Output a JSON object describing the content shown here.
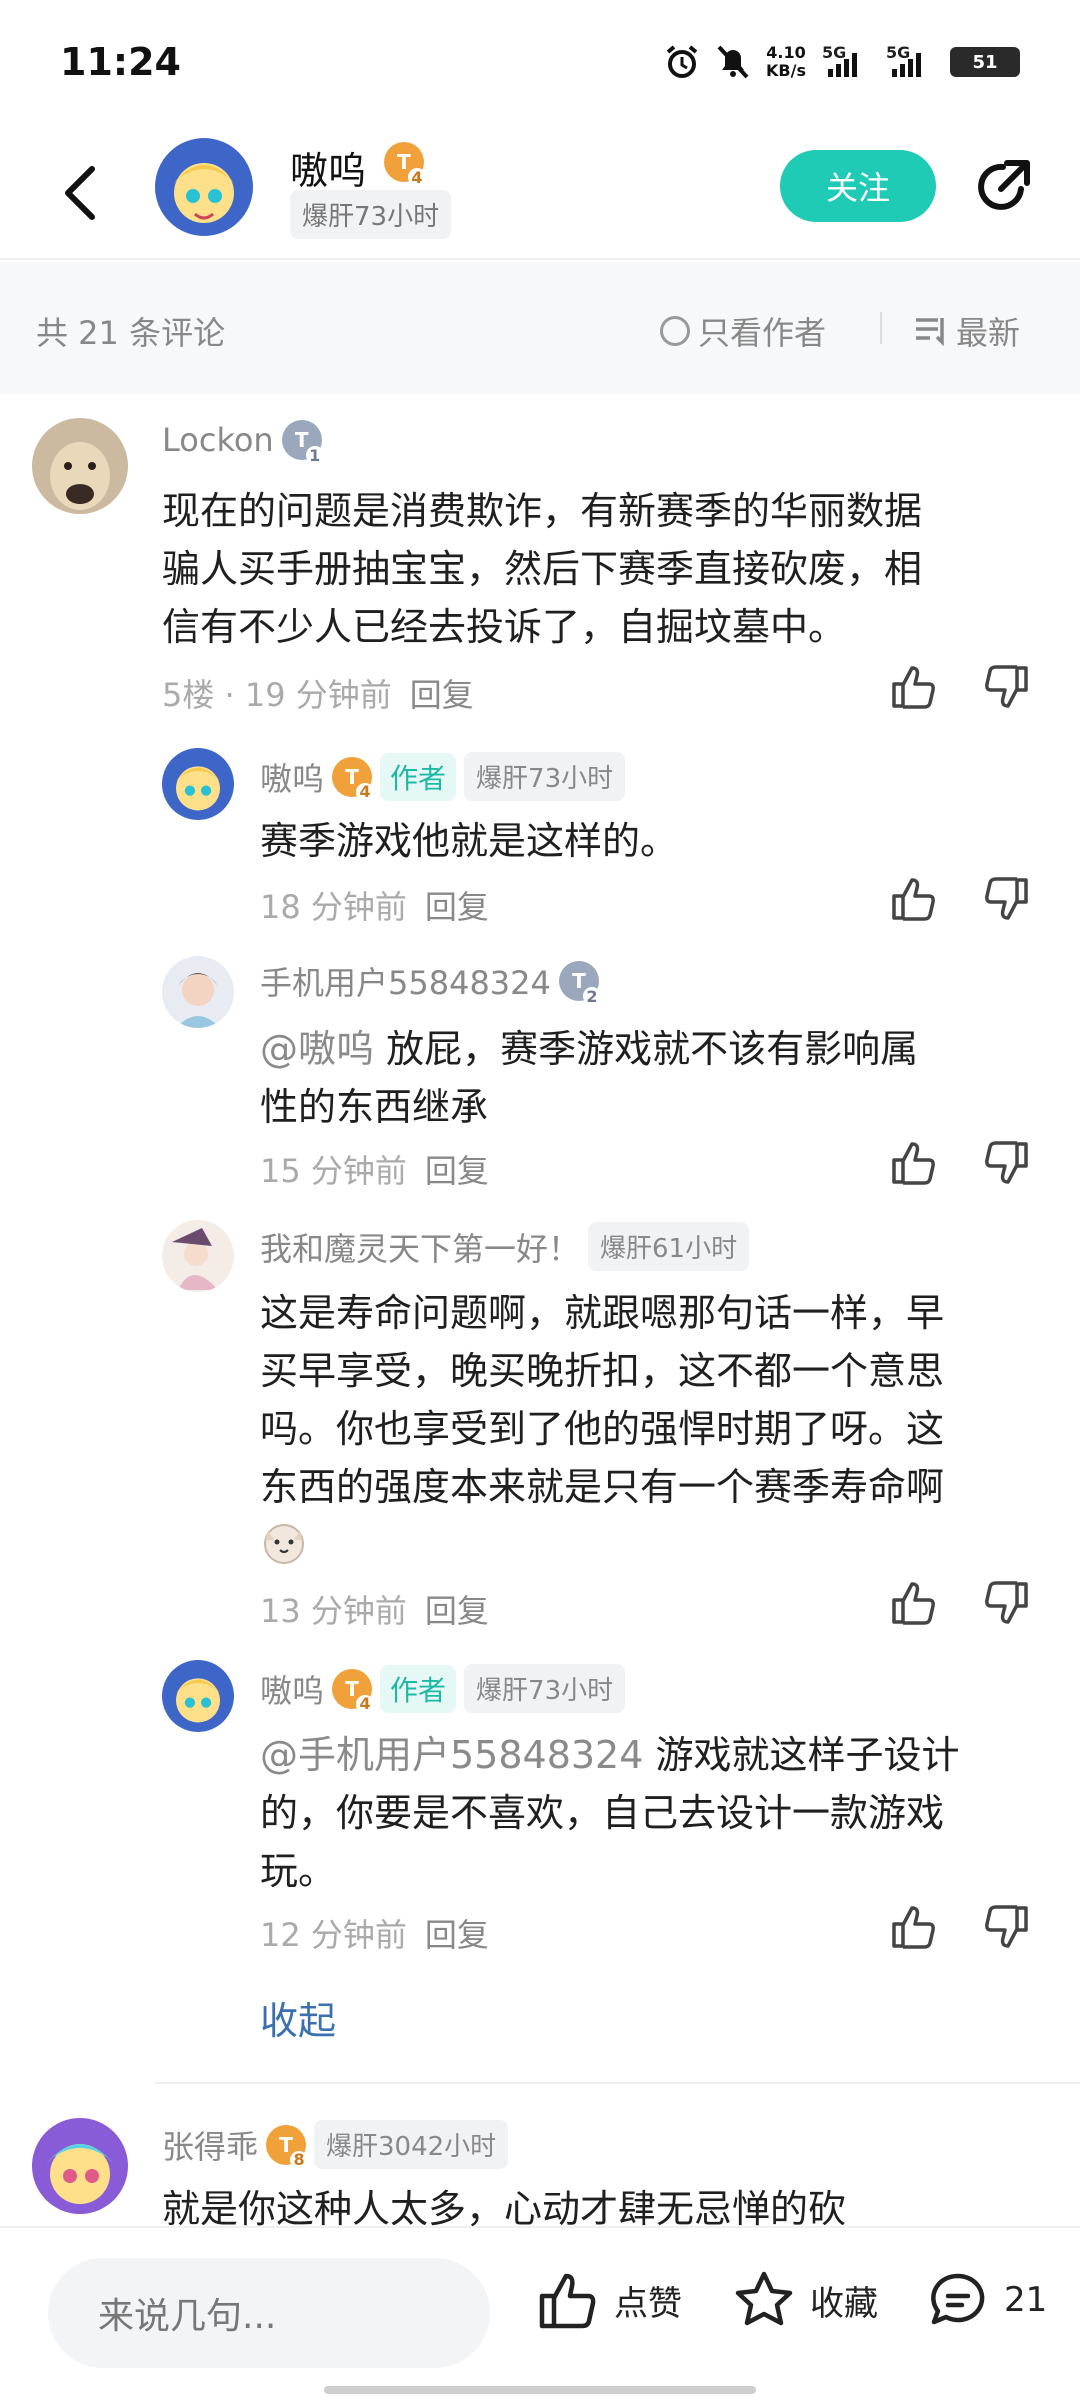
{
  "status_bar": {
    "time": "11:24",
    "net_speed_value": "4.10",
    "net_speed_unit": "KB/s",
    "sim1": "5G",
    "sim2": "5G",
    "battery": "51"
  },
  "header": {
    "author_name": "嗷呜",
    "author_level": "4",
    "author_hours": "爆肝73小时",
    "follow_label": "关注"
  },
  "filter": {
    "count_label": "共 21 条评论",
    "only_author_label": "只看作者",
    "sort_label": "最新"
  },
  "comments": [
    {
      "user": "Lockon",
      "level": "1",
      "text": [
        "现在的问题是消费欺诈，有新赛季的华丽数据",
        "骗人买手册抽宝宝，然后下赛季直接砍废，相",
        "信有不少人已经去投诉了，自掘坟墓中。"
      ],
      "floor_time": "5楼 · 19 分钟前",
      "reply": "回复"
    },
    {
      "user": "嗷呜",
      "level": "4",
      "author_chip": "作者",
      "hours": "爆肝73小时",
      "text": [
        "赛季游戏他就是这样的。"
      ],
      "time": "18 分钟前",
      "reply": "回复"
    },
    {
      "user": "手机用户55848324",
      "level": "2",
      "mention": "@嗷呜",
      "text": [
        " 放屁，赛季游戏就不该有影响属",
        "性的东西继承"
      ],
      "time": "15 分钟前",
      "reply": "回复"
    },
    {
      "user": "我和魔灵天下第一好！",
      "hours": "爆肝61小时",
      "text": [
        "这是寿命问题啊，就跟嗯那句话一样，早",
        "买早享受，晚买晚折扣，这不都一个意思",
        "吗。你也享受到了他的强悍时期了呀。这",
        "东西的强度本来就是只有一个赛季寿命啊"
      ],
      "time": "13 分钟前",
      "reply": "回复"
    },
    {
      "user": "嗷呜",
      "level": "4",
      "author_chip": "作者",
      "hours": "爆肝73小时",
      "mention": "@手机用户55848324",
      "text": [
        " 游戏就这样子设计",
        "的，你要是不喜欢，自己去设计一款游戏",
        "玩。"
      ],
      "time": "12 分钟前",
      "reply": "回复"
    },
    {
      "user": "张得乖",
      "level": "8",
      "hours": "爆肝3042小时",
      "text": [
        "就是你这种人太多，心动才肆无忌惮的砍"
      ]
    }
  ],
  "collapse_label": "收起",
  "bottom": {
    "input_placeholder": "来说几句...",
    "like_label": "点赞",
    "fav_label": "收藏",
    "comment_count": "21"
  },
  "colors": {
    "accent": "#1fcbb5",
    "link": "#3a6fb0",
    "badge_gold": "#f0a13a"
  }
}
